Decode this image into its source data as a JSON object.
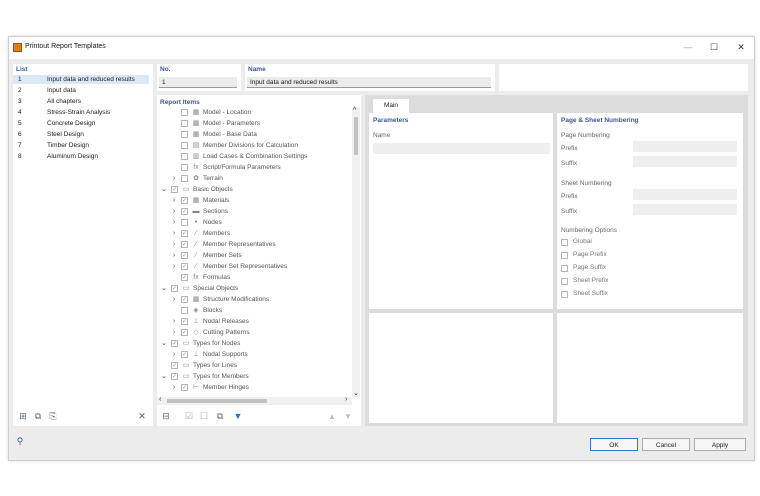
{
  "window": {
    "title": "Printout Report Templates",
    "minimize": "—",
    "maximize": "☐",
    "close": "✕"
  },
  "list": {
    "header": "List",
    "items": [
      {
        "num": "1",
        "label": "Input data and reduced results",
        "selected": true
      },
      {
        "num": "2",
        "label": "Input data"
      },
      {
        "num": "3",
        "label": "All chapters"
      },
      {
        "num": "4",
        "label": "Stress-Strain Analysis"
      },
      {
        "num": "5",
        "label": "Concrete Design"
      },
      {
        "num": "6",
        "label": "Steel Design"
      },
      {
        "num": "7",
        "label": "Timber Design"
      },
      {
        "num": "8",
        "label": "Aluminum Design"
      }
    ]
  },
  "no": {
    "label": "No.",
    "value": "1"
  },
  "name": {
    "label": "Name",
    "value": "Input data and reduced results"
  },
  "report_items": {
    "header": "Report Items",
    "rows": [
      {
        "exp": "",
        "cb": "",
        "icon": "▦",
        "label": "Model - Location",
        "indent": 1
      },
      {
        "exp": "",
        "cb": "",
        "icon": "▦",
        "label": "Model - Parameters",
        "indent": 1
      },
      {
        "exp": "",
        "cb": "",
        "icon": "▦",
        "label": "Model - Base Data",
        "indent": 1
      },
      {
        "exp": "",
        "cb": "",
        "icon": "▤",
        "label": "Member Divisions for Calculation",
        "indent": 1
      },
      {
        "exp": "",
        "cb": "",
        "icon": "▥",
        "label": "Load Cases & Combination Settings",
        "indent": 1
      },
      {
        "exp": "",
        "cb": "",
        "icon": "fx",
        "label": "Script/Formula Parameters",
        "indent": 1
      },
      {
        "exp": "›",
        "cb": "",
        "icon": "✿",
        "label": "Terrain",
        "indent": 1
      },
      {
        "exp": "⌄",
        "cb": "✓",
        "icon": "▭",
        "label": "Basic Objects",
        "indent": 0
      },
      {
        "exp": "›",
        "cb": "✓",
        "icon": "▦",
        "label": "Materials",
        "indent": 1
      },
      {
        "exp": "›",
        "cb": "✓",
        "icon": "▬",
        "label": "Sections",
        "indent": 1
      },
      {
        "exp": "›",
        "cb": "",
        "icon": "•",
        "label": "Nodes",
        "indent": 1
      },
      {
        "exp": "›",
        "cb": "✓",
        "icon": "∕",
        "label": "Members",
        "indent": 1
      },
      {
        "exp": "›",
        "cb": "✓",
        "icon": "∕",
        "label": "Member Representatives",
        "indent": 1
      },
      {
        "exp": "›",
        "cb": "✓",
        "icon": "∕",
        "label": "Member Sets",
        "indent": 1
      },
      {
        "exp": "›",
        "cb": "✓",
        "icon": "∕",
        "label": "Member Set Representatives",
        "indent": 1
      },
      {
        "exp": "",
        "cb": "✓",
        "icon": "fx",
        "label": "Formulas",
        "indent": 1
      },
      {
        "exp": "⌄",
        "cb": "✓",
        "icon": "▭",
        "label": "Special Objects",
        "indent": 0
      },
      {
        "exp": "›",
        "cb": "✓",
        "icon": "▦",
        "label": "Structure Modifications",
        "indent": 1
      },
      {
        "exp": "",
        "cb": "",
        "icon": "◈",
        "label": "Blocks",
        "indent": 1
      },
      {
        "exp": "›",
        "cb": "✓",
        "icon": "⊥",
        "label": "Nodal Releases",
        "indent": 1
      },
      {
        "exp": "›",
        "cb": "✓",
        "icon": "◇",
        "label": "Cutting Patterns",
        "indent": 1
      },
      {
        "exp": "⌄",
        "cb": "✓",
        "icon": "▭",
        "label": "Types for Nodes",
        "indent": 0
      },
      {
        "exp": "›",
        "cb": "✓",
        "icon": "⊥",
        "label": "Nodal Supports",
        "indent": 1
      },
      {
        "exp": "",
        "cb": "✓",
        "icon": "▭",
        "label": "Types for Lines",
        "indent": 0
      },
      {
        "exp": "⌄",
        "cb": "✓",
        "icon": "▭",
        "label": "Types for Members",
        "indent": 0
      },
      {
        "exp": "›",
        "cb": "✓",
        "icon": "⊢",
        "label": "Member Hinges",
        "indent": 1
      }
    ]
  },
  "tabs": {
    "main": "Main"
  },
  "parameters": {
    "header": "Parameters",
    "name_label": "Name"
  },
  "numbering": {
    "header": "Page & Sheet Numbering",
    "page_numbering": "Page Numbering",
    "page_prefix_label": "Prefix",
    "page_suffix_label": "Suffix",
    "sheet_numbering": "Sheet Numbering",
    "sheet_prefix_label": "Prefix",
    "sheet_suffix_label": "Suffix",
    "options_header": "Numbering Options",
    "options": [
      "Global",
      "Page Prefix",
      "Page Suffix",
      "Sheet Prefix",
      "Sheet Suffix"
    ]
  },
  "footer": {
    "ok": "OK",
    "cancel": "Cancel",
    "apply": "Apply"
  },
  "icons": {
    "list_toolbar": [
      "new-template-icon",
      "copy-template-icon",
      "import-template-icon",
      "delete-icon"
    ],
    "tree_toolbar": [
      "select-all-icon",
      "check-all-icon",
      "uncheck-all-icon",
      "copy-icon",
      "filter-icon",
      "move-up-icon",
      "move-down-icon"
    ],
    "help": "help-icon"
  }
}
